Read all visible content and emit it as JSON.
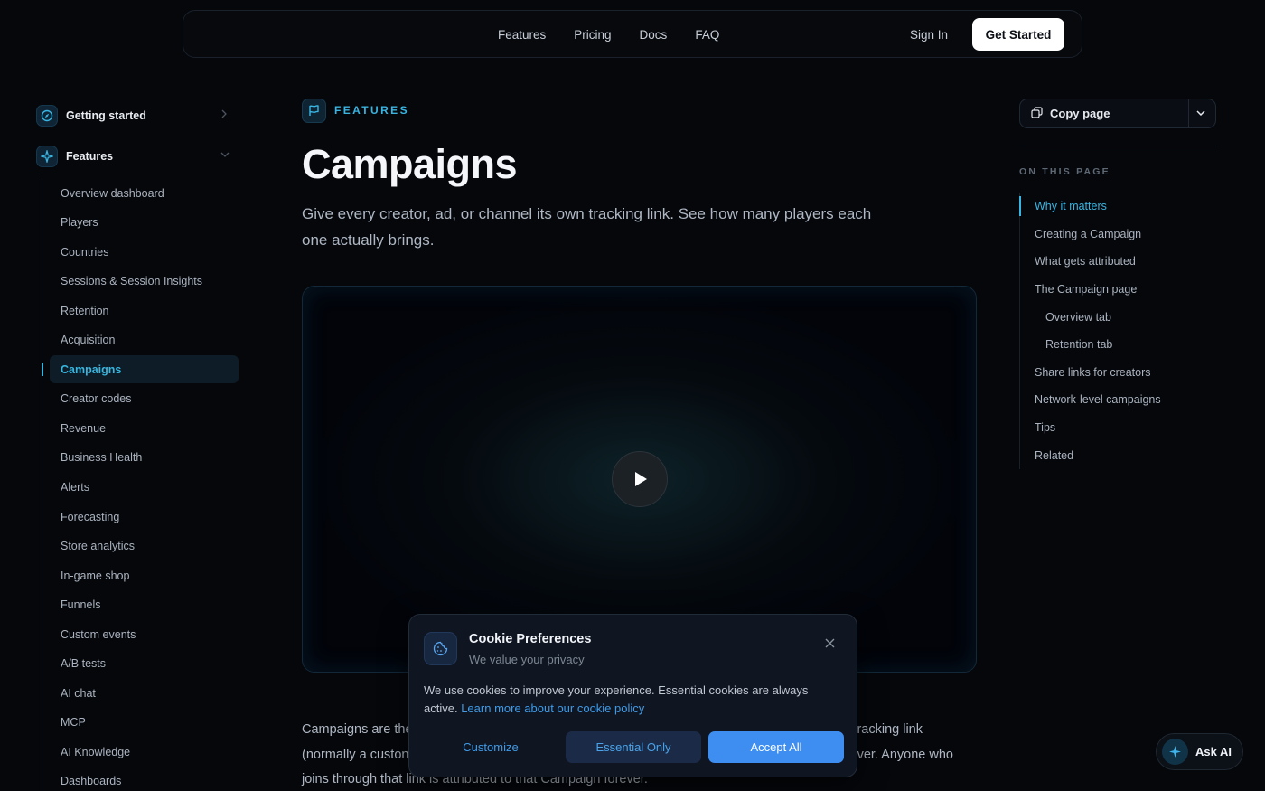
{
  "topnav": {
    "links": [
      "Features",
      "Pricing",
      "Docs",
      "FAQ"
    ],
    "sign_in": "Sign In",
    "get_started": "Get Started"
  },
  "sidebar": {
    "sections": [
      {
        "label": "Getting started",
        "icon": "compass-icon",
        "expanded": false
      },
      {
        "label": "Features",
        "icon": "sparkle-icon",
        "expanded": true
      }
    ],
    "items": [
      "Overview dashboard",
      "Players",
      "Countries",
      "Sessions & Session Insights",
      "Retention",
      "Acquisition",
      "Campaigns",
      "Creator codes",
      "Revenue",
      "Business Health",
      "Alerts",
      "Forecasting",
      "Store analytics",
      "In-game shop",
      "Funnels",
      "Custom events",
      "A/B tests",
      "AI chat",
      "MCP",
      "AI Knowledge",
      "Dashboards"
    ],
    "active_item": "Campaigns"
  },
  "main": {
    "eyebrow": "FEATURES",
    "eyebrow_icon": "flag-icon",
    "title": "Campaigns",
    "subtitle": "Give every creator, ad, or channel its own tracking link. See how many players each one actually brings.",
    "video_icon": "play-icon",
    "body_line1_start": "Campaigns are the",
    "body_line1_end": "racking link",
    "body_line2_start": "(normally a custon",
    "body_line2_end": "ver. Anyone who",
    "body_line3": "joins through that link is attributed to that Campaign forever."
  },
  "toc": {
    "copy_label": "Copy page",
    "heading": "ON THIS PAGE",
    "items": [
      {
        "label": "Why it matters",
        "level": 1,
        "active": true
      },
      {
        "label": "Creating a Campaign",
        "level": 1
      },
      {
        "label": "What gets attributed",
        "level": 1
      },
      {
        "label": "The Campaign page",
        "level": 1
      },
      {
        "label": "Overview tab",
        "level": 2
      },
      {
        "label": "Retention tab",
        "level": 2
      },
      {
        "label": "Share links for creators",
        "level": 1
      },
      {
        "label": "Network-level campaigns",
        "level": 1
      },
      {
        "label": "Tips",
        "level": 1
      },
      {
        "label": "Related",
        "level": 1
      }
    ]
  },
  "cookie": {
    "title": "Cookie Preferences",
    "subtitle": "We value your privacy",
    "body": "We use cookies to improve your experience. Essential cookies are always active.",
    "link": "Learn more about our cookie policy",
    "customize": "Customize",
    "essential_only": "Essential Only",
    "accept_all": "Accept All",
    "icon": "cookie-icon"
  },
  "ask_ai": {
    "label": "Ask AI",
    "icon": "sparkle-icon"
  },
  "colors": {
    "accent": "#38b5e2",
    "background": "#05070b",
    "primary_button": "#3d8ef0"
  }
}
